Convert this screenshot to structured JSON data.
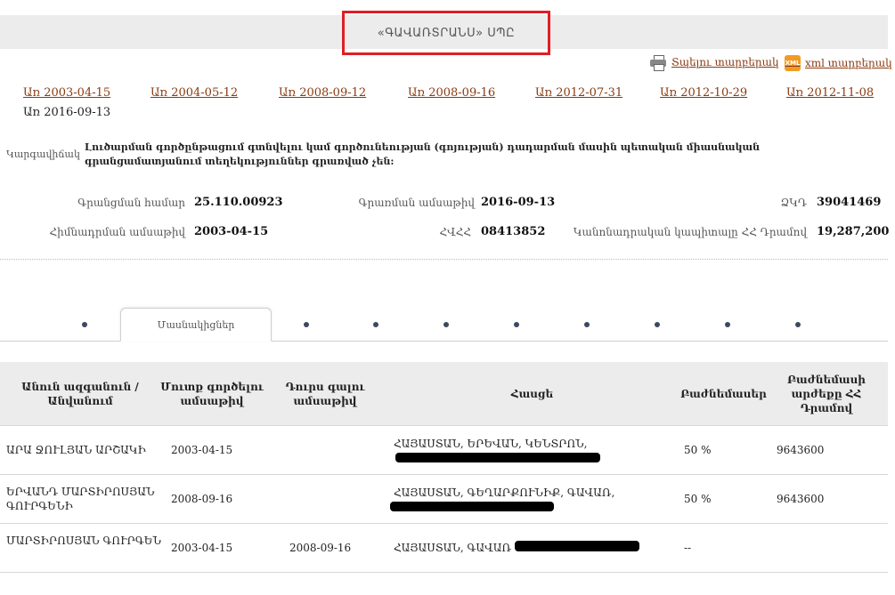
{
  "header": {
    "title": "«ԳԱՎԱՌՏՐԱՆՍ» ՍՊԸ"
  },
  "links": {
    "print": "Տպելու տարբերակ",
    "xml_icon": "XML",
    "xml": "xml տարբերակ"
  },
  "dates": [
    "Առ 2003-04-15",
    "Առ 2004-05-12",
    "Առ 2008-09-12",
    "Առ 2008-09-16",
    "Առ 2012-07-31",
    "Առ 2012-10-29",
    "Առ 2012-11-08"
  ],
  "current_date": "Առ 2016-09-13",
  "status": {
    "label": "Կարգավիճակ",
    "text": "Լուծարման գործընթացում գտնվելու կամ գործունեության (գոյության) դադարման մասին պետական միասնական գրանցամատյանում տեղեկություններ գրառված չեն:"
  },
  "fields": {
    "reg_number_label": "Գրանցման համար",
    "reg_number": "25.110.00923",
    "record_date_label": "Գրառման ամսաթիվ",
    "record_date": "2016-09-13",
    "tin_label": "ՀՎՀՀ",
    "tin": "08413852",
    "founding_date_label": "Հիմնադրման ամսաթիվ",
    "founding_date": "2003-04-15",
    "code_label": "ՁԿԴ",
    "code": "39041469",
    "capital_label": "Կանոնադրական կապիտալը ՀՀ Դրամով",
    "capital": "19,287,200"
  },
  "tabs": {
    "active": "Մասնակիցներ"
  },
  "table": {
    "headers": [
      "Անուն ազգանուն / Անվանում",
      "Մուտք գործելու ամսաթիվ",
      "Դուրս գալու ամսաթիվ",
      "Հասցե",
      "Բաժնեմասեր",
      "Բաժնեմասի արժեքը ՀՀ Դրամով"
    ],
    "rows": [
      {
        "name": "ԱՐԱ ՋՈՒԼՅԱՆ ԱՐՇԱԿԻ",
        "entry": "2003-04-15",
        "exit": "",
        "address": "ՀԱՅԱՍՏԱՆ, ԵՐԵՎԱՆ, ԿԵՆՏՐՈՆ,",
        "share": "50 %",
        "value": "9643600"
      },
      {
        "name": "ԵՐՎԱՆԴ ՄԱՐՏԻՐՈՍՅԱՆ ԳՈՒՐԳԵՆԻ",
        "entry": "2008-09-16",
        "exit": "",
        "address": "ՀԱՅԱՍՏԱՆ, ԳԵՂԱՐՔՈՒՆԻՔ, ԳԱՎԱՌ,",
        "share": "50 %",
        "value": "9643600"
      },
      {
        "name": "ՄԱՐՏԻՐՈՍՅԱՆ ԳՈՒՐԳԵՆ",
        "entry": "2003-04-15",
        "exit": "2008-09-16",
        "address": "ՀԱՅԱՍՏԱՆ, ԳԱՎԱՌ",
        "share": "--",
        "value": ""
      }
    ]
  }
}
